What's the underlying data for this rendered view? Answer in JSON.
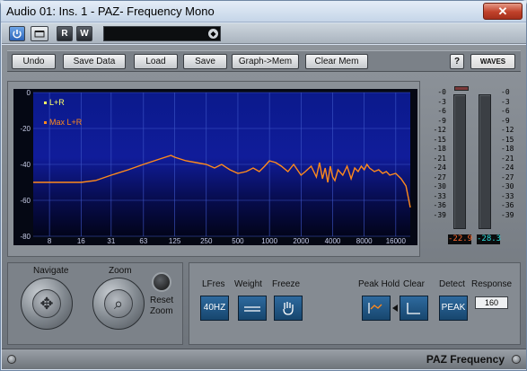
{
  "window": {
    "title": "Audio 01: Ins. 1 - PAZ- Frequency Mono",
    "close_symbol": "✕"
  },
  "host_toolbar": {
    "power_icon": "power-icon",
    "bypass_icon": "bypass-icon",
    "read_label": "R",
    "write_label": "W",
    "preset_value": "",
    "preset_arrow": "◆"
  },
  "waves_toolbar": {
    "buttons": [
      "Undo",
      "Save Data",
      "Load",
      "Save",
      "Graph->Mem",
      "Clear Mem"
    ],
    "help_label": "?",
    "logo_text": "WAVES"
  },
  "graph": {
    "legend": [
      {
        "label": "L+R",
        "color": "#ffff66"
      },
      {
        "label": "Max L+R",
        "color": "#ff8a1c"
      }
    ],
    "y_ticks": [
      "0",
      "-20",
      "-40",
      "-60",
      "-80"
    ],
    "x_ticks": [
      "8",
      "16",
      "31",
      "63",
      "125",
      "250",
      "500",
      "1000",
      "2000",
      "4000",
      "8000",
      "16000"
    ]
  },
  "chart_data": {
    "type": "line",
    "title": "",
    "xlabel": "",
    "ylabel": "",
    "x_scale": "log",
    "xlim": [
      5.6,
      22000
    ],
    "ylim": [
      -80,
      0
    ],
    "grid": true,
    "legend_position": "top-left",
    "series": [
      {
        "name": "Max L+R",
        "color": "#ff8a1c",
        "x": [
          5.6,
          16,
          22,
          31,
          45,
          63,
          90,
          115,
          125,
          160,
          200,
          250,
          300,
          350,
          420,
          500,
          600,
          700,
          800,
          900,
          1000,
          1150,
          1300,
          1500,
          1700,
          2000,
          2200,
          2500,
          2800,
          3000,
          3200,
          3400,
          3600,
          3800,
          4000,
          4200,
          4500,
          5000,
          5500,
          6000,
          6500,
          7000,
          7500,
          8000,
          8500,
          9000,
          10000,
          11000,
          12000,
          13000,
          14000,
          16000,
          18000,
          20000,
          22000
        ],
        "y": [
          -50,
          -50,
          -49,
          -46,
          -43,
          -40,
          -37,
          -35,
          -36,
          -38,
          -39,
          -40,
          -42,
          -40,
          -43,
          -45,
          -44,
          -42,
          -44,
          -41,
          -38,
          -39,
          -41,
          -44,
          -40,
          -46,
          -44,
          -41,
          -47,
          -39,
          -48,
          -42,
          -50,
          -41,
          -47,
          -49,
          -43,
          -46,
          -41,
          -48,
          -42,
          -44,
          -41,
          -43,
          -40,
          -42,
          -44,
          -43,
          -45,
          -44,
          -46,
          -45,
          -48,
          -52,
          -64
        ]
      }
    ]
  },
  "meters": {
    "scale_left": [
      "-0",
      "-3",
      "-6",
      "-9",
      "-12",
      "-15",
      "-18",
      "-21",
      "-24",
      "-27",
      "-30",
      "-33",
      "-36",
      "-39"
    ],
    "scale_right": [
      "-0",
      "-3",
      "-6",
      "-9",
      "-12",
      "-15",
      "-18",
      "-21",
      "-24",
      "-27",
      "-30",
      "-33",
      "-36",
      "-39"
    ],
    "left_peak": "-22.9",
    "right_peak": "-28.3",
    "left_color": "#ff6a30",
    "right_color": "#30e0e0"
  },
  "navigation": {
    "navigate_label": "Navigate",
    "zoom_label": "Zoom",
    "reset_label_1": "Reset",
    "reset_label_2": "Zoom",
    "navigate_icon": "✥",
    "zoom_icon": "⌕"
  },
  "controls": {
    "lfres_label": "LFres",
    "lfres_value": "40HZ",
    "weight_label": "Weight",
    "freeze_label": "Freeze",
    "peakhold_label": "Peak Hold",
    "clear_label": "Clear",
    "detect_label": "Detect",
    "detect_value": "PEAK",
    "response_label": "Response",
    "response_value": "160"
  },
  "footer": {
    "product_name": "PAZ Frequency"
  }
}
